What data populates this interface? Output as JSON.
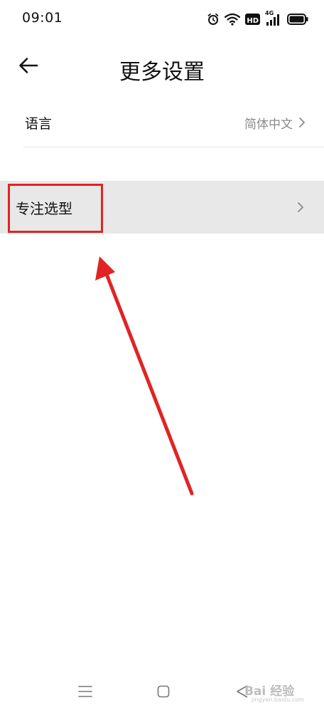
{
  "status_bar": {
    "time": "09:01",
    "icons": [
      "alarm-icon",
      "wifi-icon",
      "hd-icon",
      "signal-4g-icon",
      "battery-icon"
    ],
    "network_label": "4G",
    "hd_label": "HD"
  },
  "header": {
    "title": "更多设置",
    "back_icon": "arrow-left-icon"
  },
  "settings": {
    "language": {
      "label": "语言",
      "value": "简体中文"
    },
    "focus_selection": {
      "label": "专注选型"
    }
  },
  "nav_bar": {
    "icons": [
      "menu-icon",
      "home-square-icon",
      "back-triangle-icon"
    ]
  },
  "watermark": {
    "text": "Bai 经验",
    "sub": "jingyan.baidu.com"
  },
  "colors": {
    "annotation": "#e02424",
    "highlight_row": "#e8e8e8",
    "secondary_text": "#8a8a8a",
    "divider": "#e5e5e5"
  }
}
